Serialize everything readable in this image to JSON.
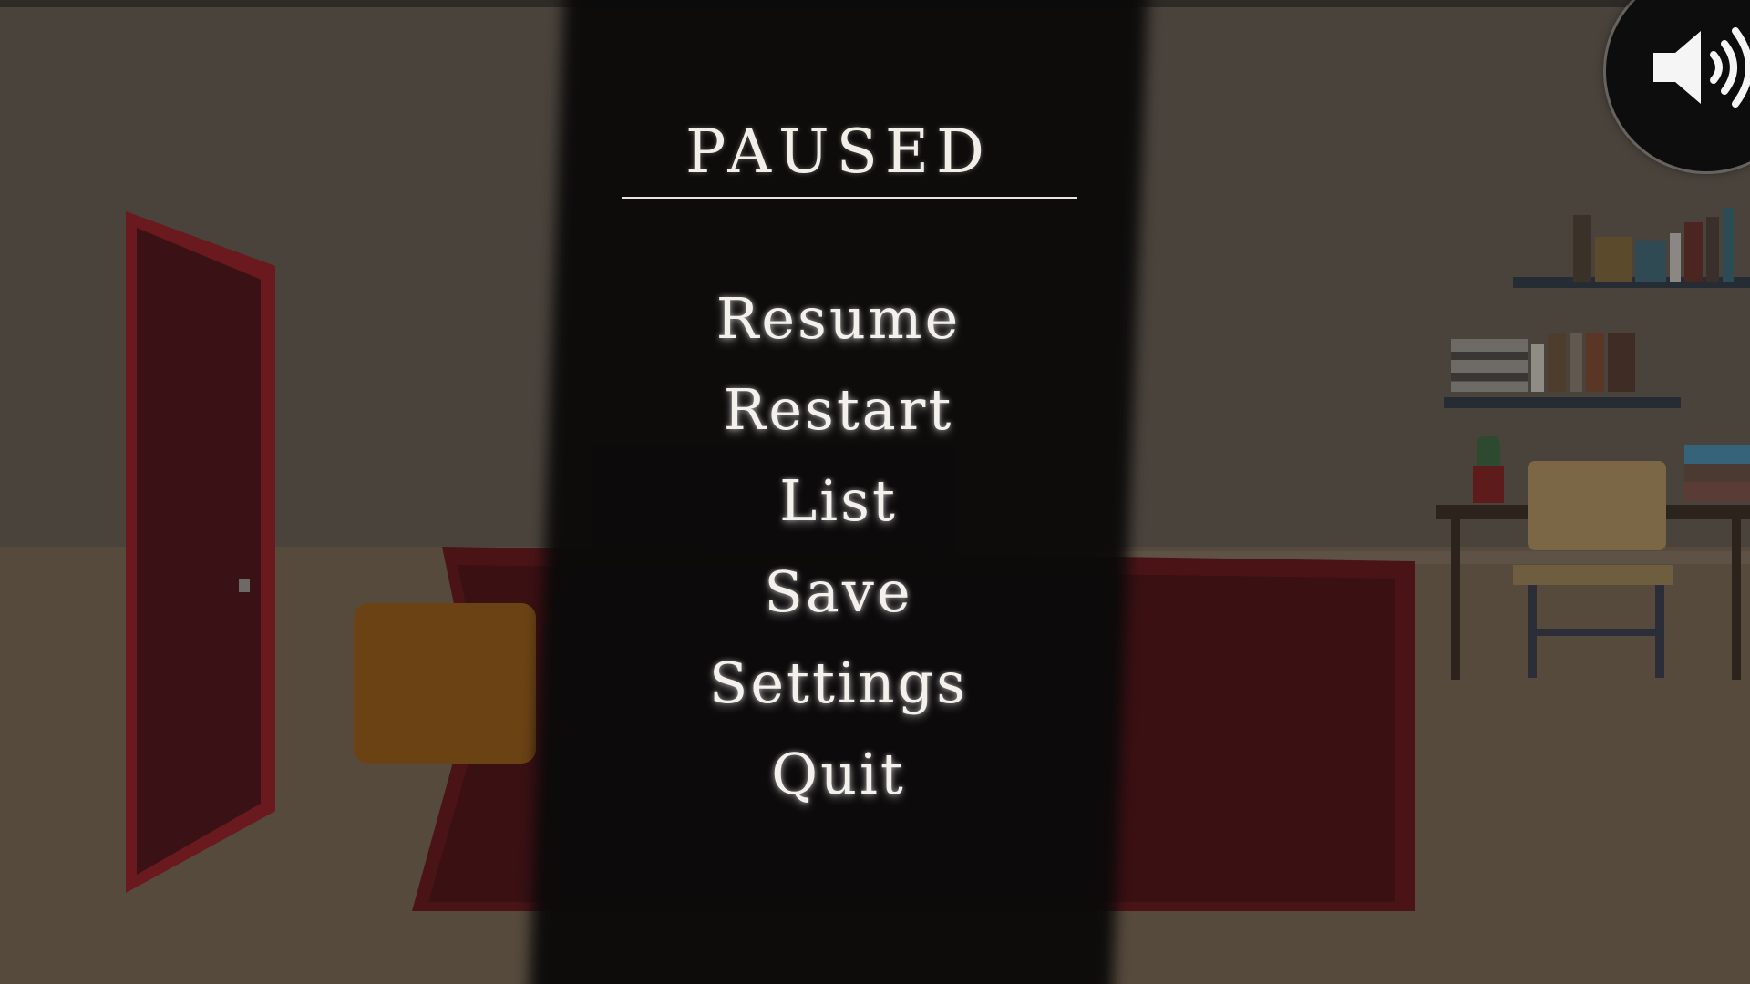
{
  "pause_menu": {
    "title": "PAUSED",
    "items": [
      {
        "label": "Resume"
      },
      {
        "label": "Restart"
      },
      {
        "label": "List"
      },
      {
        "label": "Save"
      },
      {
        "label": "Settings"
      },
      {
        "label": "Quit"
      }
    ]
  },
  "sound_button": {
    "icon": "speaker-volume-icon"
  },
  "colors": {
    "panel": "#0b0a0a",
    "text": "#f4f1ec",
    "door": "#6a1a1e",
    "bedspread": "#4a1417"
  }
}
